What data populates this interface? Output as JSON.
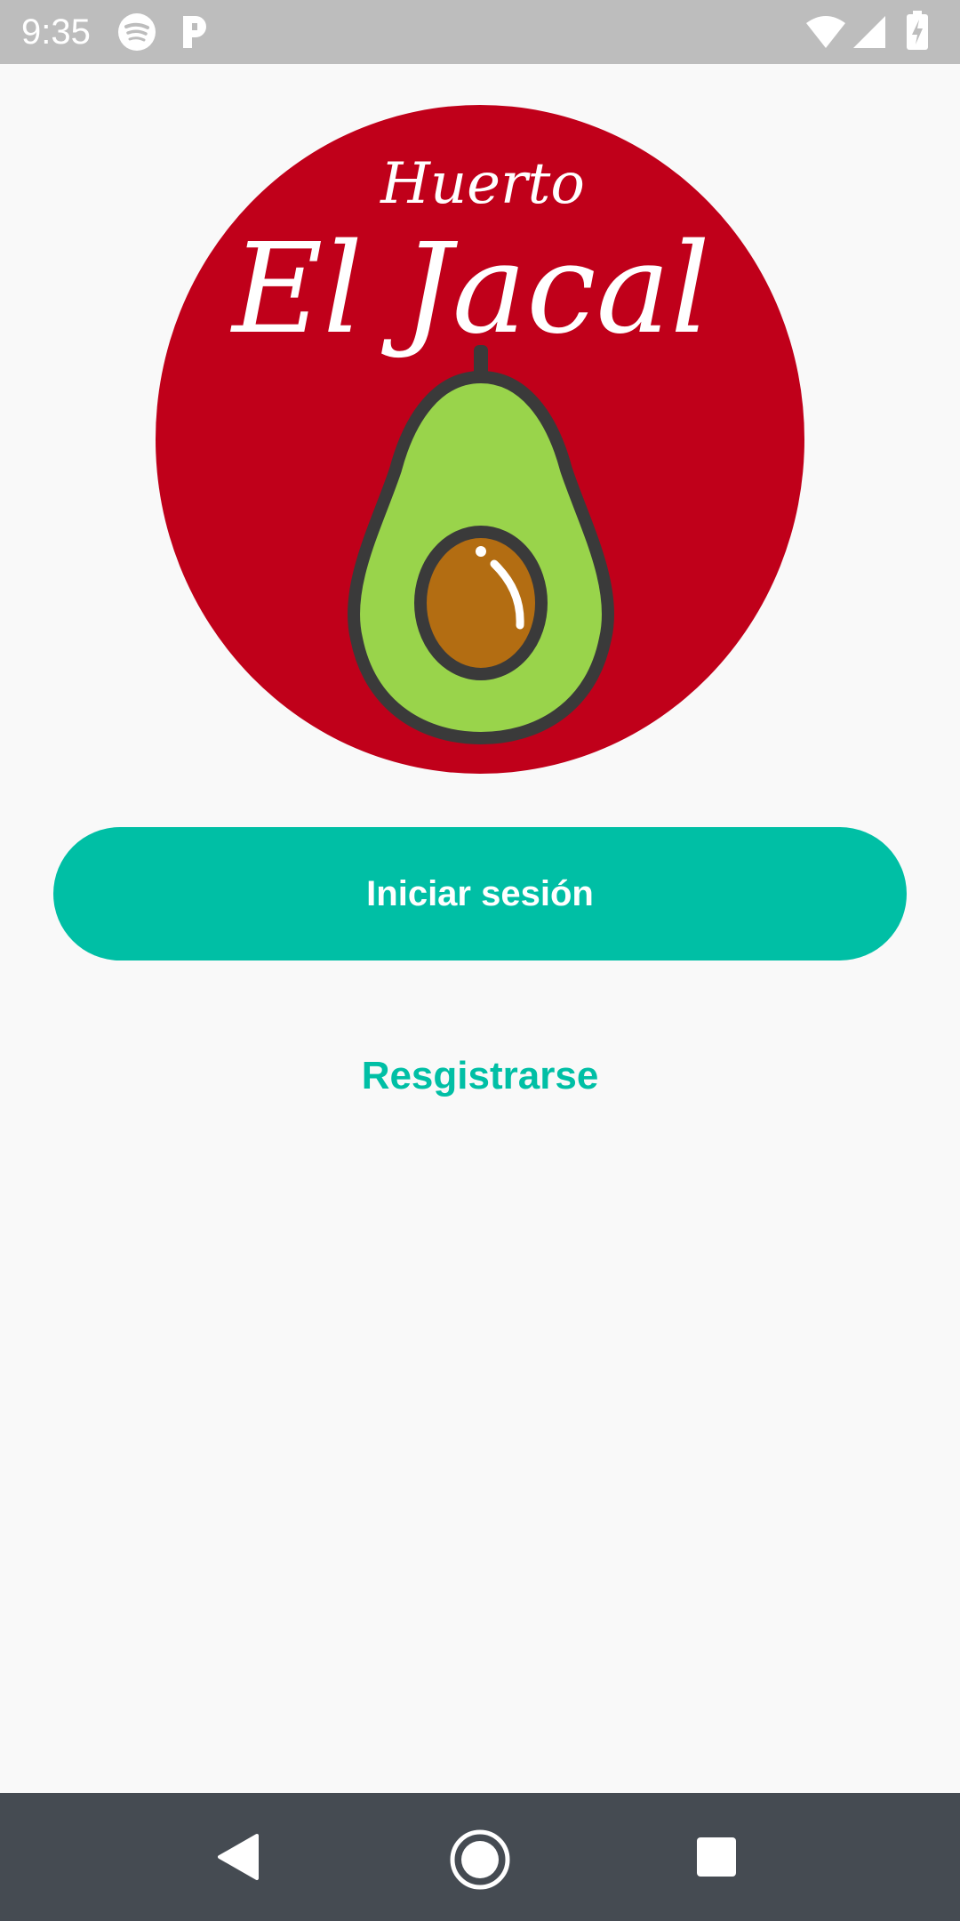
{
  "status_bar": {
    "time": "9:35",
    "left_icons": [
      "spotify-icon",
      "pandora-icon"
    ],
    "right_icons": [
      "wifi-icon",
      "signal-icon",
      "battery-charging-icon"
    ]
  },
  "logo": {
    "top_line": "Huerto",
    "main_line": "El Jacal",
    "colors": {
      "circle": "#c0001a",
      "avocado_flesh": "#99d44b",
      "pit": "#b36d12",
      "outline": "#3a3a3a"
    }
  },
  "actions": {
    "login_label": "Iniciar sesión",
    "register_label": "Resgistrarse"
  },
  "nav_bar": {
    "icons": [
      "back-icon",
      "home-icon",
      "recents-icon"
    ]
  },
  "colors": {
    "accent": "#00bfa5",
    "background": "#f9f9f9",
    "status_bar": "#bdbdbd",
    "nav_bar": "#454b52"
  }
}
